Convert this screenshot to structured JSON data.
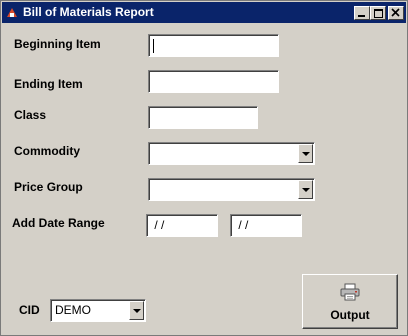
{
  "window": {
    "title": "Bill of Materials Report",
    "icon": "app-icon",
    "controls": [
      "minimize-icon",
      "maximize-icon",
      "close-icon"
    ]
  },
  "form": {
    "beginning_item": {
      "label": "Beginning Item",
      "value": ""
    },
    "ending_item": {
      "label": "Ending Item",
      "value": ""
    },
    "class": {
      "label": "Class",
      "value": ""
    },
    "commodity": {
      "label": "Commodity",
      "value": ""
    },
    "price_group": {
      "label": "Price Group",
      "value": ""
    },
    "date_range": {
      "label": "Add Date Range",
      "start": " / /",
      "end": " / /"
    },
    "cid": {
      "label": "CID",
      "value": "DEMO"
    }
  },
  "output_button": {
    "label": "Output",
    "icon": "printer-icon"
  }
}
